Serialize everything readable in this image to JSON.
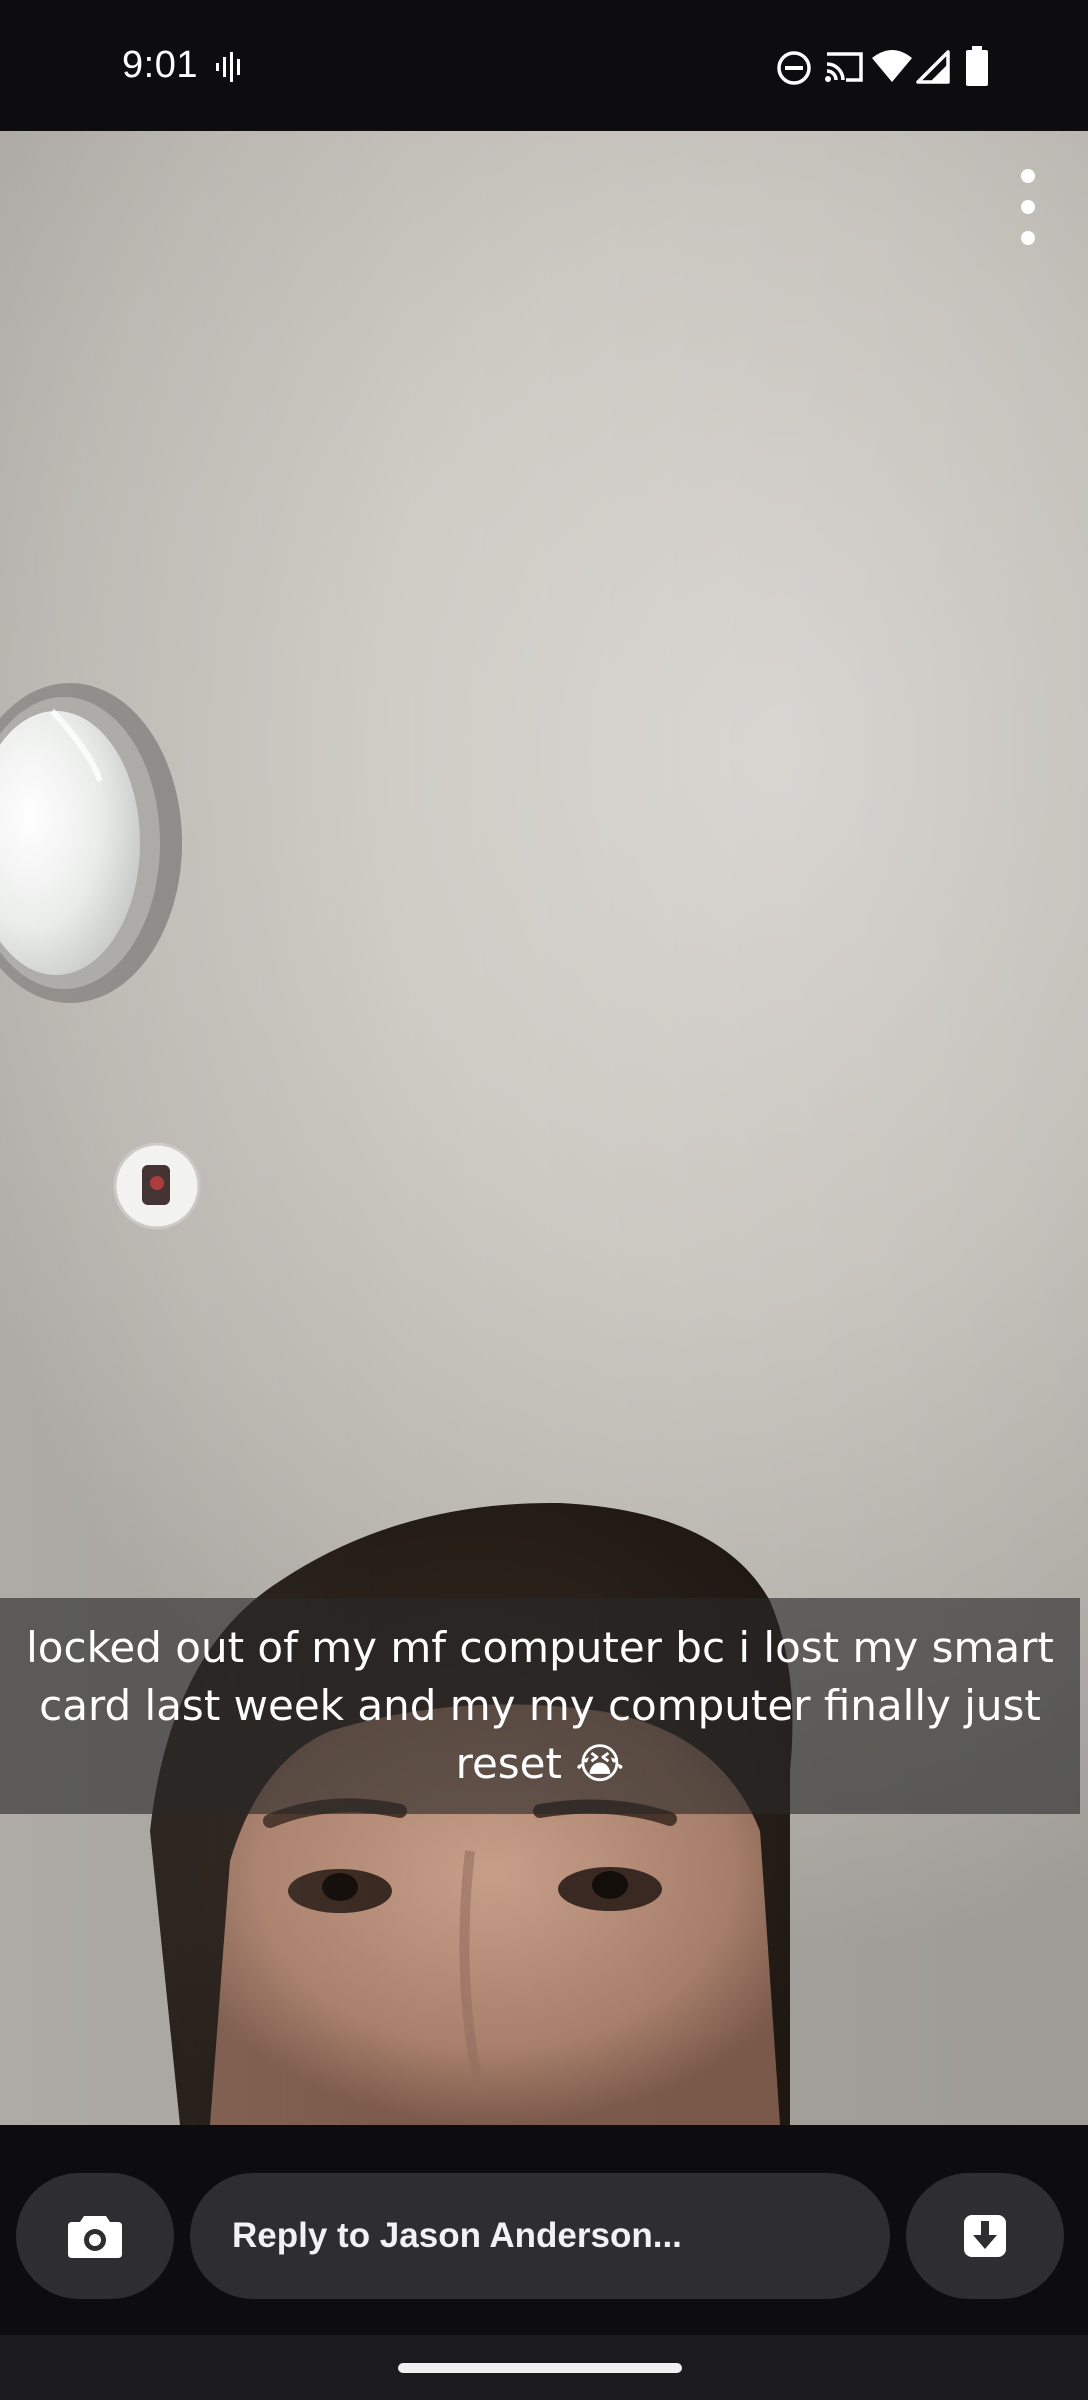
{
  "status_bar": {
    "time": "9:01",
    "icons": [
      "voice-activity-icon",
      "do-not-disturb-icon",
      "cast-icon",
      "wifi-icon",
      "cell-signal-icon",
      "battery-icon"
    ]
  },
  "snap": {
    "caption": "locked out of my mf computer bc i lost my smart card last week and my my computer finally just reset 😭",
    "menu_icon": "more-vertical-icon"
  },
  "reply_bar": {
    "placeholder": "Reply to Jason Anderson...",
    "camera_icon": "camera-icon",
    "save_icon": "save-download-icon"
  },
  "colors": {
    "background": "#0d0d0f",
    "control": "#2e2e30",
    "caption_overlay": "rgba(40,40,40,0.62)",
    "text": "#ffffff"
  }
}
